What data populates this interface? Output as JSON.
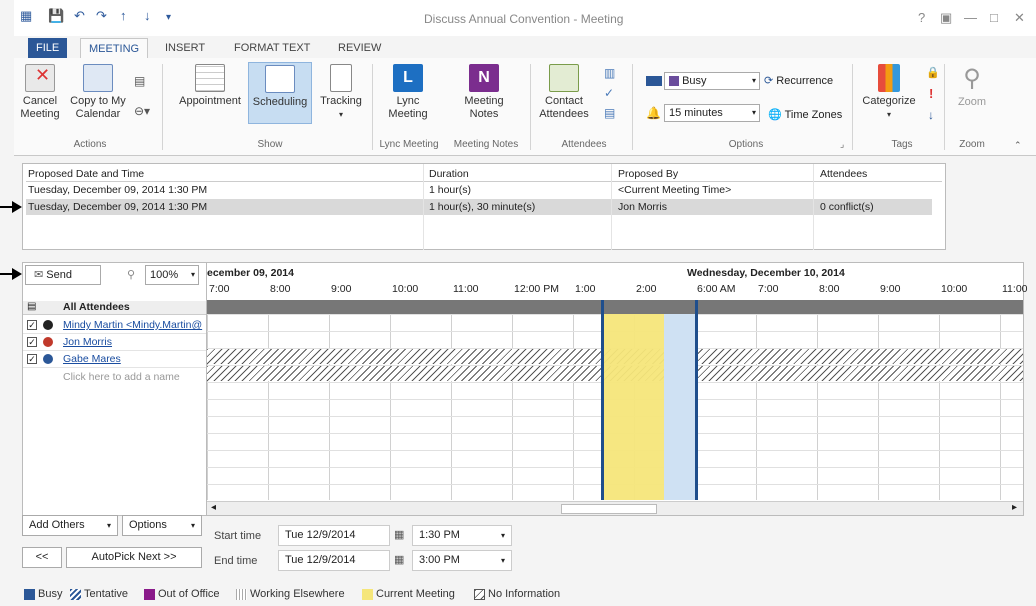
{
  "window": {
    "title": "Discuss Annual Convention - Meeting",
    "help": "?",
    "ribbon_toggle": "▣",
    "minimize": "—",
    "maximize": "□",
    "close": "✕"
  },
  "tabs": [
    "FILE",
    "MEETING",
    "INSERT",
    "FORMAT TEXT",
    "REVIEW"
  ],
  "ribbon": {
    "cancel_meeting": "Cancel\nMeeting",
    "copy_calendar": "Copy to My\nCalendar",
    "appointment": "Appointment",
    "scheduling": "Scheduling",
    "tracking": "Tracking",
    "lync_meeting": "Lync\nMeeting",
    "meeting_notes": "Meeting\nNotes",
    "contact_attendees": "Contact\nAttendees",
    "show_as": "Busy",
    "recurrence": "Recurrence",
    "reminder": "15 minutes",
    "time_zones": "Time Zones",
    "categorize": "Categorize",
    "zoom": "Zoom",
    "groups": {
      "actions": "Actions",
      "show": "Show",
      "lync": "Lync Meeting",
      "notes": "Meeting Notes",
      "attendees": "Attendees",
      "options": "Options",
      "tags": "Tags",
      "zoom": "Zoom"
    }
  },
  "proposed": {
    "headers": [
      "Proposed Date and Time",
      "Duration",
      "Proposed By",
      "Attendees"
    ],
    "rows": [
      [
        "Tuesday, December 09, 2014 1:30 PM",
        "1 hour(s)",
        "<Current Meeting Time>",
        ""
      ],
      [
        "Tuesday, December 09, 2014 1:30 PM",
        "1 hour(s), 30 minute(s)",
        "Jon Morris",
        "0 conflict(s)"
      ]
    ]
  },
  "toolbar": {
    "send": "Send",
    "zoom": "100%"
  },
  "days": {
    "day1": "ecember 09, 2014",
    "day2": "Wednesday, December 10, 2014"
  },
  "times": [
    "7:00",
    "8:00",
    "9:00",
    "10:00",
    "11:00",
    "12:00 PM",
    "1:00",
    "2:00",
    "6:00 AM",
    "7:00",
    "8:00",
    "9:00",
    "10:00",
    "11:00"
  ],
  "attendees_header": "All Attendees",
  "attendees": [
    {
      "name": "Mindy Martin <Mindy.Martin@",
      "status_color": "#222"
    },
    {
      "name": "Jon Morris",
      "status_color": "#c0392b"
    },
    {
      "name": "Gabe Mares",
      "status_color": "#2b5797"
    }
  ],
  "add_name_placeholder": "Click here to add a name",
  "bottom": {
    "add_others": "Add Others",
    "options": "Options",
    "prev": "<<",
    "autopick": "AutoPick Next >>",
    "start_label": "Start time",
    "end_label": "End time",
    "start_date": "Tue 12/9/2014",
    "start_time": "1:30 PM",
    "end_date": "Tue 12/9/2014",
    "end_time": "3:00 PM"
  },
  "legend": [
    {
      "label": "Busy",
      "color": "#2b5797"
    },
    {
      "label": "Tentative",
      "color": "#7a9cd0"
    },
    {
      "label": "Out of Office",
      "color": "#8a1a8a"
    },
    {
      "label": "Working Elsewhere",
      "color": "#aaaaaa"
    },
    {
      "label": "Current Meeting",
      "color": "#f5e67a"
    },
    {
      "label": "No Information",
      "color": "#555555"
    }
  ]
}
